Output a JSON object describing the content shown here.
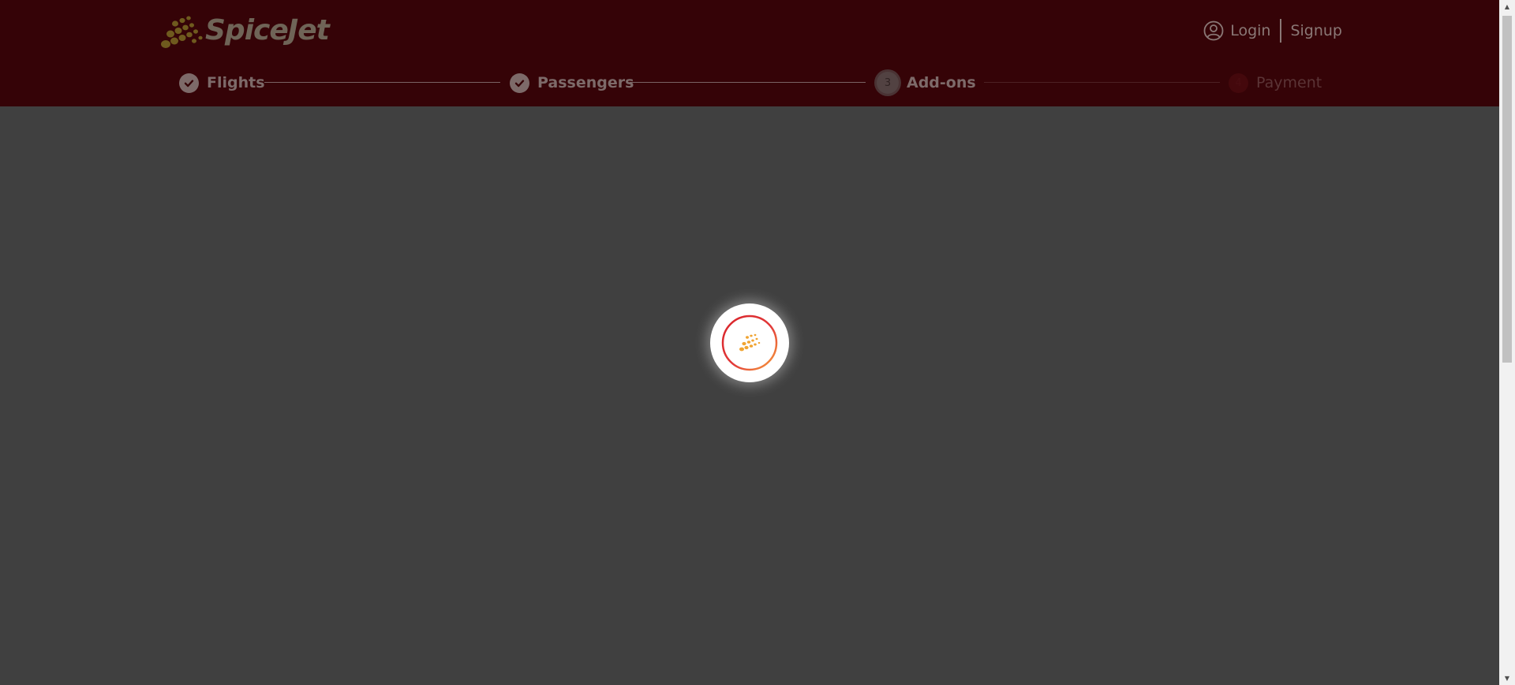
{
  "brand": {
    "name": "SpiceJet",
    "color": "#350307"
  },
  "auth": {
    "login_label": "Login",
    "signup_label": "Signup"
  },
  "stepper": {
    "steps": [
      {
        "label": "Flights",
        "state": "done",
        "icon": "check-icon"
      },
      {
        "label": "Passengers",
        "state": "done",
        "icon": "check-icon"
      },
      {
        "label": "Add-ons",
        "state": "current",
        "number": "3"
      },
      {
        "label": "Payment",
        "state": "pending",
        "number": "4"
      }
    ]
  },
  "loader": {
    "icon": "spicejet-spinner-icon",
    "ring_colors": [
      "#d8232a",
      "#f7a23b"
    ]
  },
  "overlay_color": "#404040"
}
